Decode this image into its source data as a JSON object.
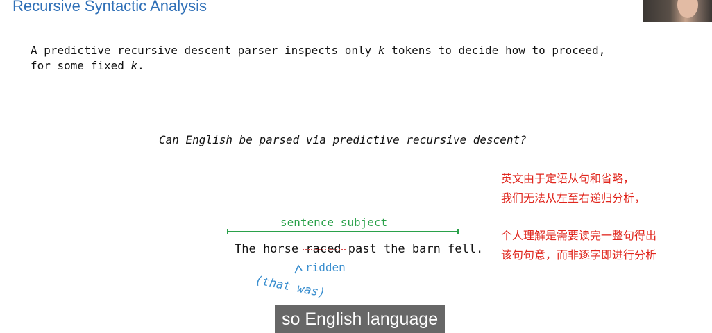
{
  "slide": {
    "title": "Recursive Syntactic Analysis",
    "definition_line1": "A predictive recursive descent parser inspects only ",
    "definition_k1": "k",
    "definition_line1_end": " tokens to decide how to proceed,",
    "definition_line2": "for some fixed ",
    "definition_k2": "k",
    "definition_line2_end": ".",
    "question": "Can English be parsed via predictive recursive descent?",
    "subject_label": "sentence subject",
    "sentence_the": "The horse ",
    "sentence_raced": "raced",
    "sentence_rest": " past the barn fell.",
    "note_ridden": "ridden",
    "note_that_was": "(that was)"
  },
  "annotation": {
    "line1": "英文由于定语从句和省略，",
    "line2": "我们无法从左至右递归分析，",
    "line3": "个人理解是需要读完一整句得出",
    "line4": "该句句意，而非逐字即进行分析"
  },
  "caption": {
    "text": "so English language"
  },
  "colors": {
    "title": "#2e6fb7",
    "annotation": "#e0261d",
    "subject": "#2aa14a",
    "note": "#3b8fcf",
    "caption_bg": "#5a5a5a"
  },
  "icons": {
    "webcam": "webcam-thumbnail",
    "insert": "caret-insert-mark"
  }
}
